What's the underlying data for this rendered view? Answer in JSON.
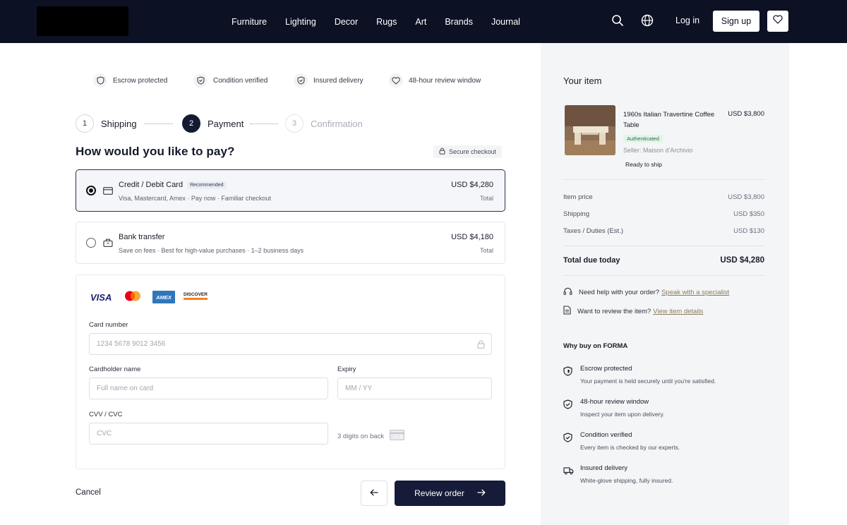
{
  "header": {
    "nav": [
      "Furniture",
      "Lighting",
      "Decor",
      "Rugs",
      "Art",
      "Brands",
      "Journal"
    ],
    "login": "Log in",
    "signup": "Sign up"
  },
  "trust": [
    "Escrow protected",
    "Condition verified",
    "Insured delivery",
    "48-hour review window"
  ],
  "steps": [
    {
      "num": "1",
      "label": "Shipping"
    },
    {
      "num": "2",
      "label": "Payment"
    },
    {
      "num": "3",
      "label": "Confirmation"
    }
  ],
  "payment": {
    "title": "How would you like to pay?",
    "secure": "Secure checkout",
    "options": [
      {
        "title": "Credit / Debit Card",
        "badge": "Recommended",
        "sub": "Visa, Mastercard, Amex · Pay now · Familiar checkout",
        "price": "USD $4,280",
        "total": "Total",
        "selected": true
      },
      {
        "title": "Bank transfer",
        "sub": "Save on fees · Best for high-value purchases · 1–2 business days",
        "price": "USD $4,180",
        "total": "Total",
        "selected": false
      }
    ]
  },
  "card_form": {
    "brands": [
      "VISA",
      "AMEX",
      "DISCOVER"
    ],
    "card_number_label": "Card number",
    "card_number_placeholder": "1234 5678 9012 3456",
    "holder_label": "Cardholder name",
    "holder_placeholder": "Full name on card",
    "expiry_label": "Expiry",
    "expiry_placeholder": "MM / YY",
    "cvv_label": "CVV / CVC",
    "cvv_placeholder": "CVC",
    "cvv_hint": "3 digits on back"
  },
  "actions": {
    "cancel": "Cancel",
    "review": "Review order"
  },
  "summary": {
    "title": "Your item",
    "item_name": "1960s Italian Travertine Coffee Table",
    "item_price": "USD $3,800",
    "authenticated": "Authenticated",
    "seller": "Seller: Maison d'Archivio",
    "ready": "Ready to ship",
    "rows": [
      {
        "label": "Item price",
        "value": "USD $3,800"
      },
      {
        "label": "Shipping",
        "value": "USD $350"
      },
      {
        "label": "Taxes / Duties (Est.)",
        "value": "USD $130"
      }
    ],
    "total_label": "Total due today",
    "total_value": "USD $4,280",
    "help1_text": "Need help with your order?",
    "help1_link": "Speak with a specialist",
    "help2_text": "Want to review the item?",
    "help2_link": "View item details",
    "why_title": "Why buy on FORMA",
    "features": [
      {
        "title": "Escrow protected",
        "sub": "Your payment is held securely until you're satisfied."
      },
      {
        "title": "48-hour review window",
        "sub": "Inspect your item upon delivery."
      },
      {
        "title": "Condition verified",
        "sub": "Every item is checked by our experts."
      },
      {
        "title": "Insured delivery",
        "sub": "White-glove shipping, fully insured."
      }
    ]
  },
  "colors": {
    "header_bg": "#0d1124",
    "primary": "#151b38",
    "side_bg": "#f4f5f7",
    "link": "#8a7a5c"
  }
}
